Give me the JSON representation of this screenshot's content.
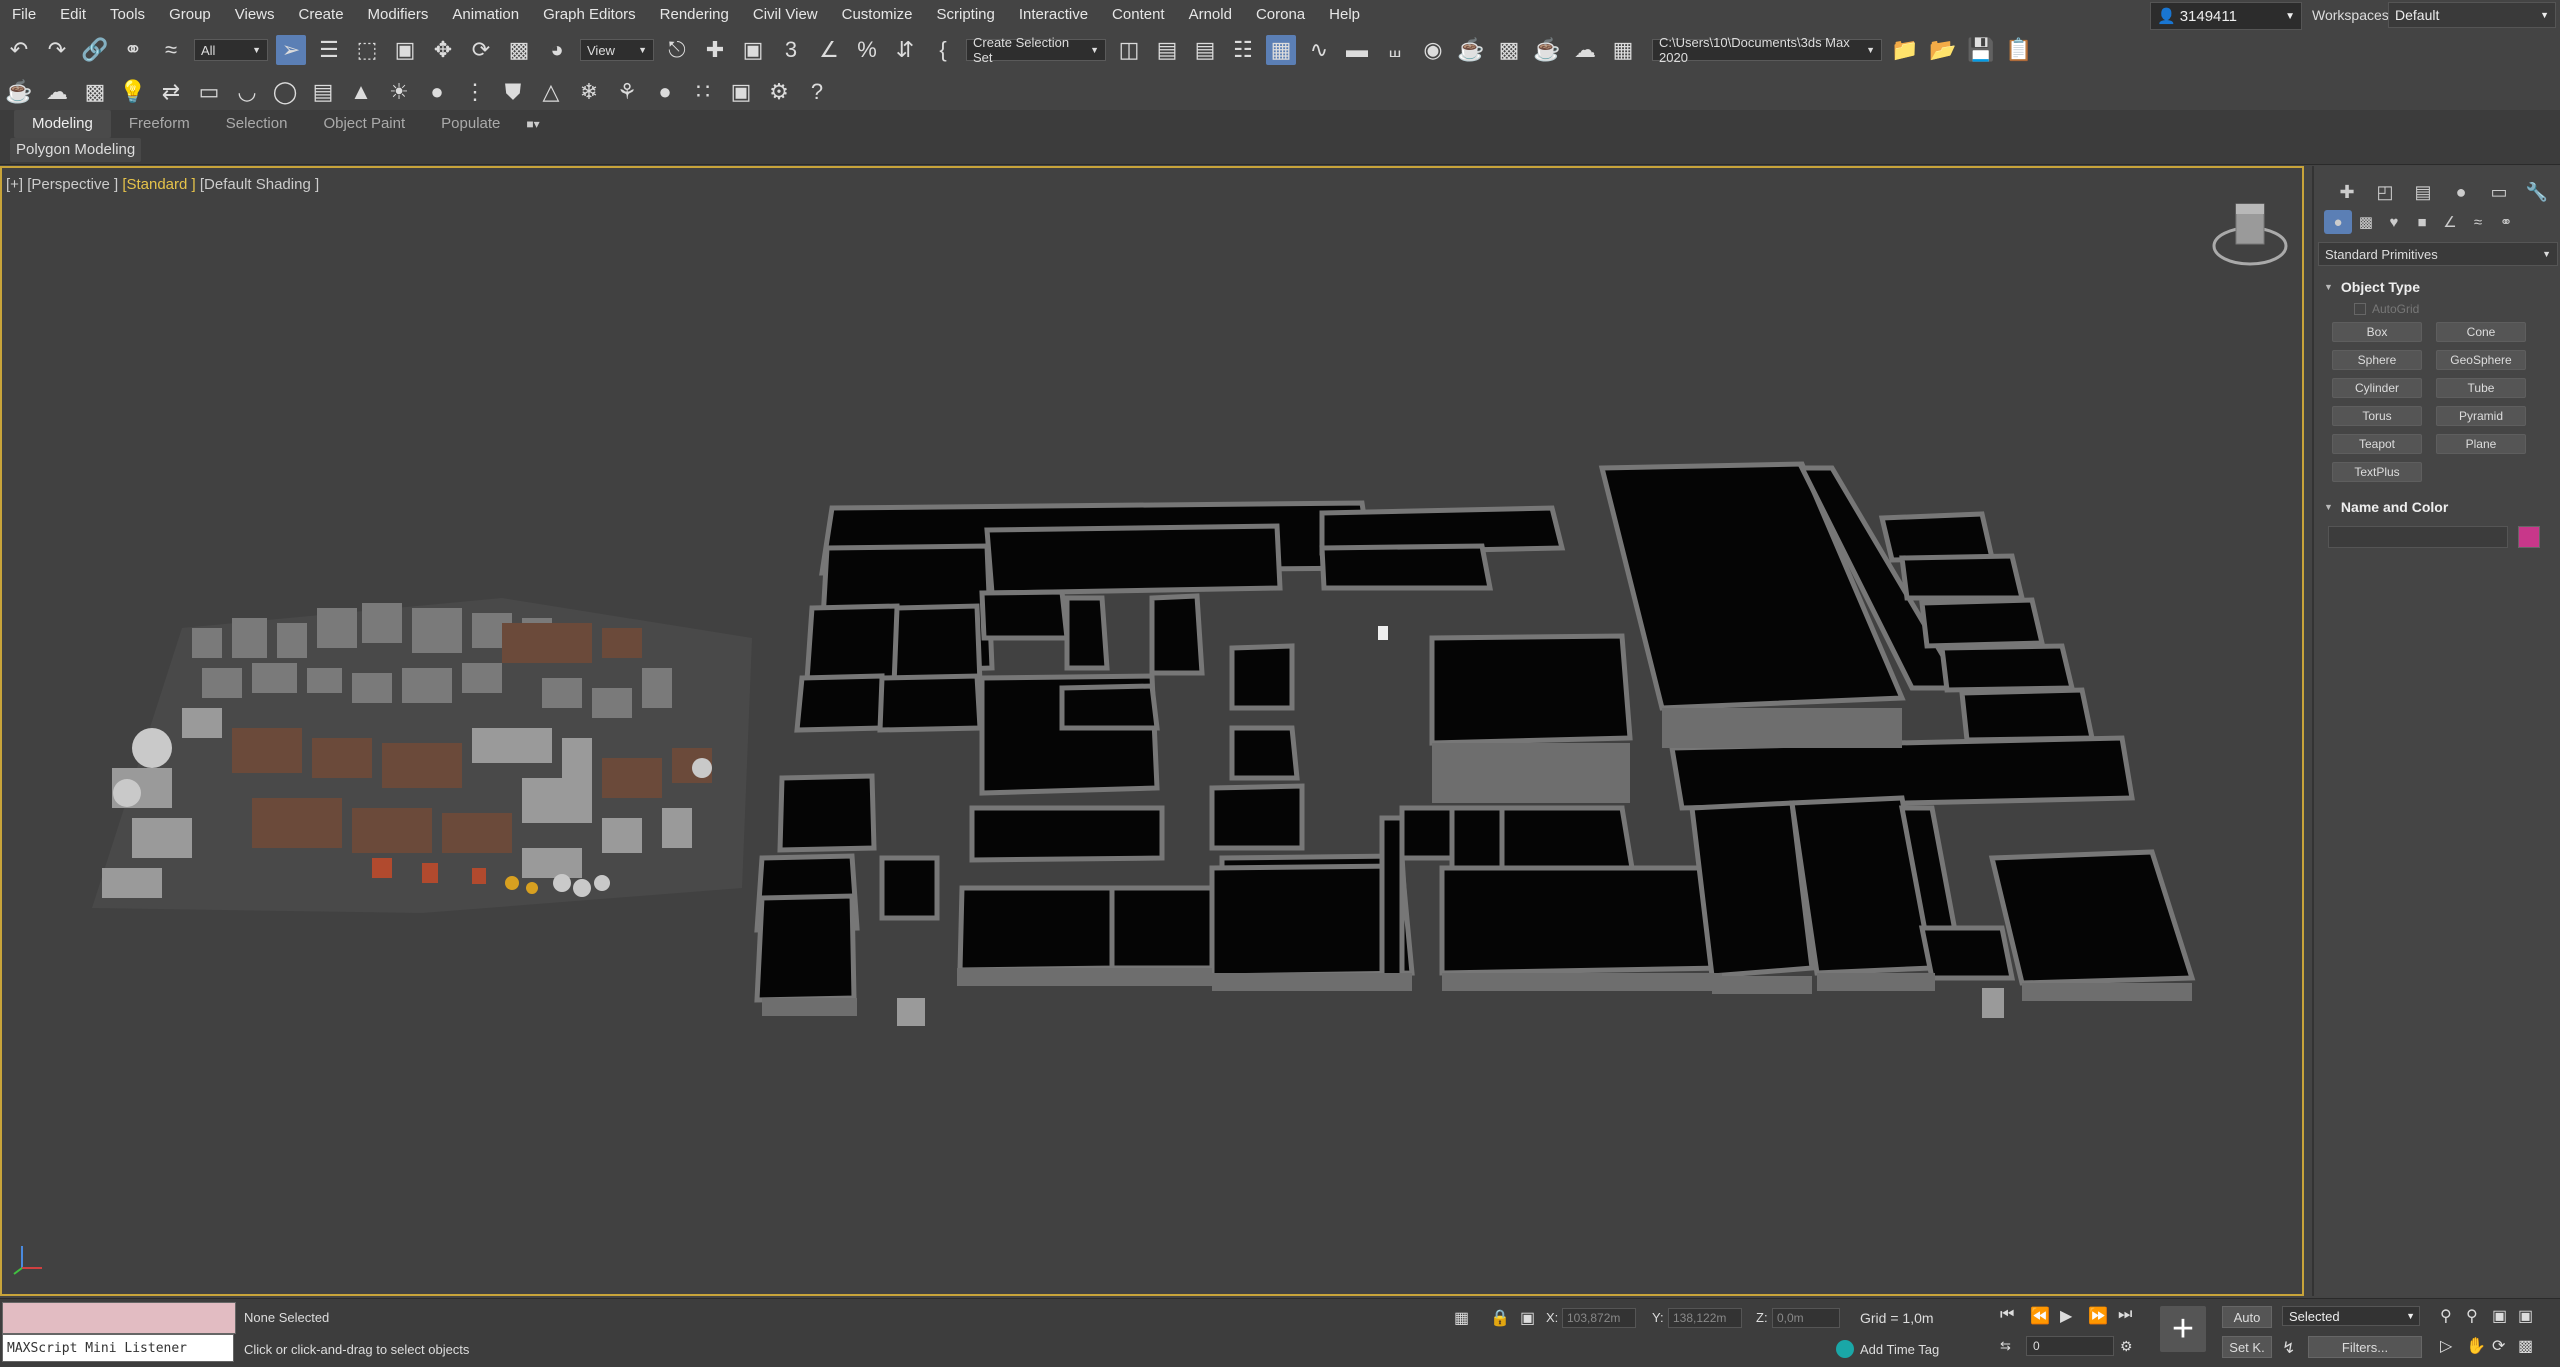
{
  "menubar": {
    "items": [
      "File",
      "Edit",
      "Tools",
      "Group",
      "Views",
      "Create",
      "Modifiers",
      "Animation",
      "Graph Editors",
      "Rendering",
      "Civil View",
      "Customize",
      "Scripting",
      "Interactive",
      "Content",
      "Arnold",
      "Corona",
      "Help"
    ],
    "user": "3149411",
    "workspaces_label": "Workspaces:",
    "workspace_value": "Default"
  },
  "toolbar": {
    "selection_filter": "All",
    "reference_coord": "View",
    "selection_set": "Create Selection Set",
    "project_path": "C:\\Users\\10\\Documents\\3ds Max 2020"
  },
  "ribbon": {
    "tabs": [
      "Modeling",
      "Freeform",
      "Selection",
      "Object Paint",
      "Populate"
    ],
    "panel": "Polygon Modeling"
  },
  "viewport": {
    "label_prefix": "[+] [Perspective ]",
    "label_standard": "[Standard ]",
    "label_shading": "[Default Shading ]"
  },
  "command_panel": {
    "category": "Standard Primitives",
    "object_type_title": "Object Type",
    "autogrid": "AutoGrid",
    "primitives": [
      "Box",
      "Cone",
      "Sphere",
      "GeoSphere",
      "Cylinder",
      "Tube",
      "Torus",
      "Pyramid",
      "Teapot",
      "Plane",
      "TextPlus"
    ],
    "name_color_title": "Name and Color",
    "object_color": "#c8378a"
  },
  "statusbar": {
    "maxscript_label": "MAXScript Mini Listener",
    "selection_status": "None Selected",
    "prompt": "Click or click-and-drag to select objects",
    "x_label": "X:",
    "x_value": "103,872m",
    "y_label": "Y:",
    "y_value": "138,122m",
    "z_label": "Z:",
    "z_value": "0,0m",
    "grid": "Grid = 1,0m",
    "add_time_tag": "Add Time Tag",
    "auto_key": "Auto",
    "set_key": "Set K.",
    "key_filter": "Selected",
    "frame": "0",
    "filters": "Filters..."
  }
}
